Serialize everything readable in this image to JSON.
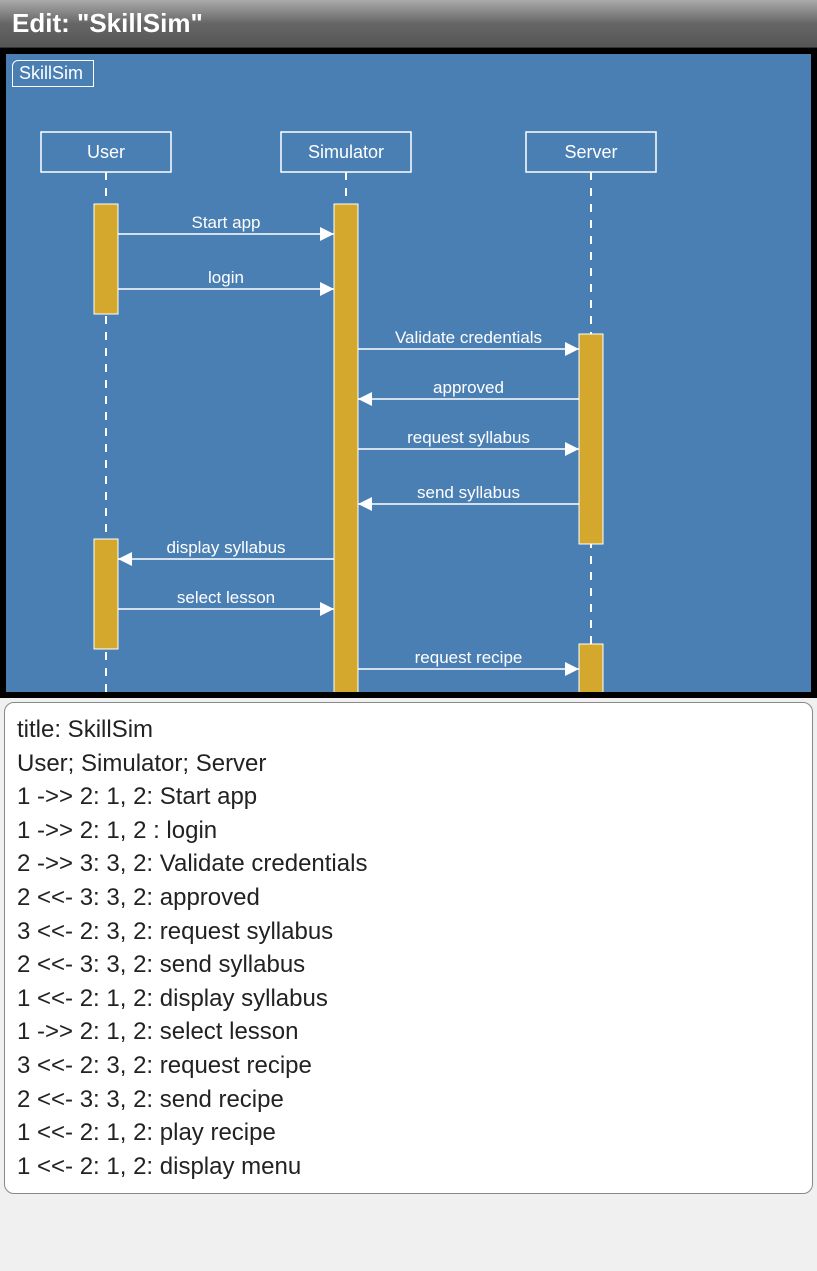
{
  "titlebar": "Edit: \"SkillSim\"",
  "diagram": {
    "tab": "SkillSim",
    "actors": [
      "User",
      "Simulator",
      "Server"
    ],
    "messages": [
      {
        "from": "User",
        "to": "Simulator",
        "label": "Start app",
        "dir": "right"
      },
      {
        "from": "User",
        "to": "Simulator",
        "label": "login",
        "dir": "right"
      },
      {
        "from": "Simulator",
        "to": "Server",
        "label": "Validate credentials",
        "dir": "right"
      },
      {
        "from": "Server",
        "to": "Simulator",
        "label": "approved",
        "dir": "left"
      },
      {
        "from": "Simulator",
        "to": "Server",
        "label": "request syllabus",
        "dir": "right"
      },
      {
        "from": "Server",
        "to": "Simulator",
        "label": "send syllabus",
        "dir": "left"
      },
      {
        "from": "Simulator",
        "to": "User",
        "label": "display syllabus",
        "dir": "left"
      },
      {
        "from": "User",
        "to": "Simulator",
        "label": "select lesson",
        "dir": "right"
      },
      {
        "from": "Simulator",
        "to": "Server",
        "label": "request recipe",
        "dir": "right"
      },
      {
        "from": "Server",
        "to": "Simulator",
        "label": "send recipe",
        "dir": "left"
      }
    ]
  },
  "code": "title: SkillSim\nUser; Simulator; Server\n1 ->> 2: 1, 2: Start app\n1 ->> 2: 1, 2 : login\n2 ->> 3: 3, 2: Validate credentials\n2 <<- 3: 3, 2: approved\n3 <<- 2: 3, 2: request syllabus\n2 <<- 3: 3, 2: send syllabus\n1 <<- 2: 1, 2: display syllabus\n1 ->> 2: 1, 2: select lesson\n3 <<- 2: 3, 2: request recipe\n2 <<- 3: 3, 2: send recipe\n1 <<- 2: 1, 2: play recipe\n1 <<- 2: 1, 2: display menu"
}
